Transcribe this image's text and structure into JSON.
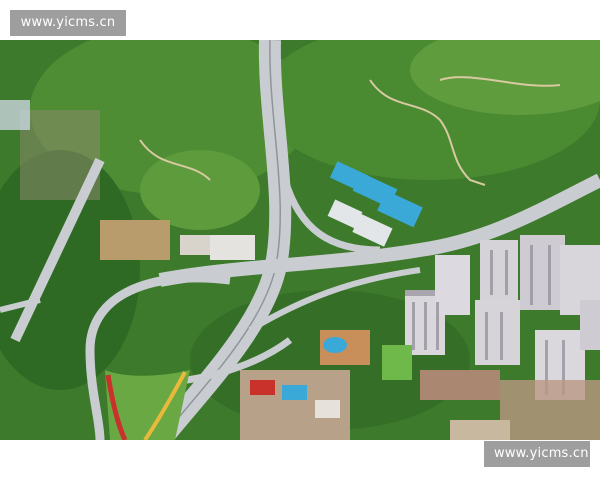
{
  "watermark_top": {
    "text": "www.yicms.cn"
  },
  "watermark_bottom": {
    "text": "www.yicms.cn"
  },
  "photo": {
    "icon": "aerial-highway-interchange-photo",
    "colors": {
      "forest": "#3f7a2e",
      "forest_light": "#6aa843",
      "road": "#c9cdd2",
      "rooftop_blue": "#3aa9d8",
      "flower_red": "#c8322a",
      "flower_yellow": "#e8b93a",
      "building": "#d9d6dc"
    }
  }
}
